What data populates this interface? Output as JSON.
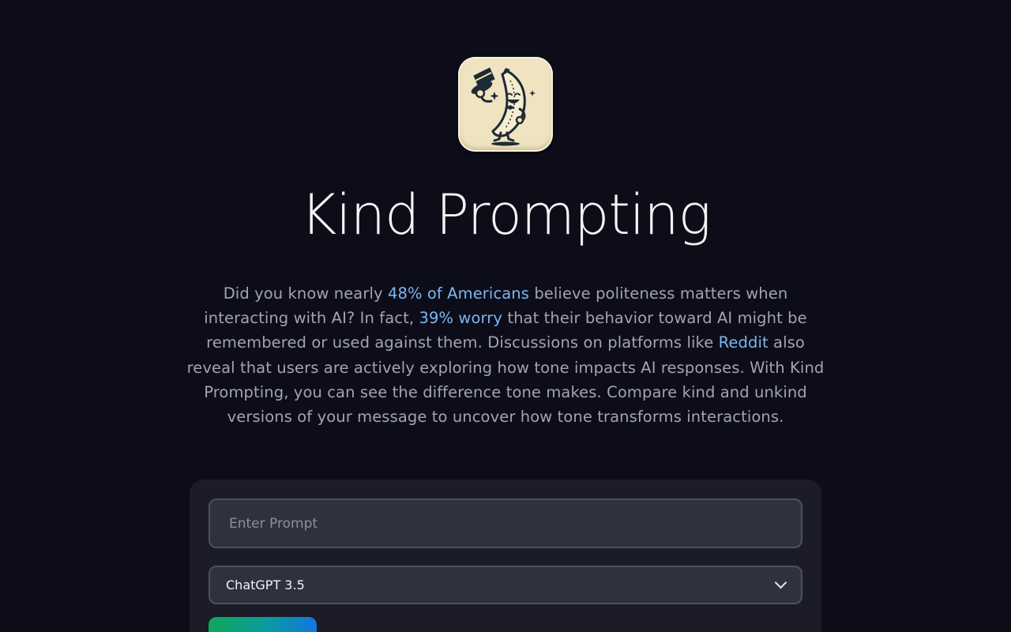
{
  "header": {
    "logo_icon": "banana-mascot-tipping-hat-icon",
    "title": "Kind Prompting"
  },
  "intro": {
    "part1": "Did you know nearly ",
    "link1": "48% of Americans",
    "part2": " believe politeness matters when interacting with AI? In fact, ",
    "link2": "39% worry",
    "part3": " that their behavior toward AI might be remembered or used against them. Discussions on platforms like ",
    "link3": "Reddit",
    "part4": " also reveal that users are actively exploring how tone impacts AI responses. With Kind Prompting, you can see the difference tone makes. Compare kind and unkind versions of your message to uncover how tone transforms interactions."
  },
  "form": {
    "prompt_placeholder": "Enter Prompt",
    "prompt_value": "",
    "model_selected": "ChatGPT 3.5",
    "submit_label": ""
  },
  "colors": {
    "background": "#0c0d18",
    "link": "#7cb6f2",
    "card": "#1b1c27",
    "input": "#30313e",
    "button_gradient_start": "#12a65a",
    "button_gradient_end": "#1178e0"
  }
}
